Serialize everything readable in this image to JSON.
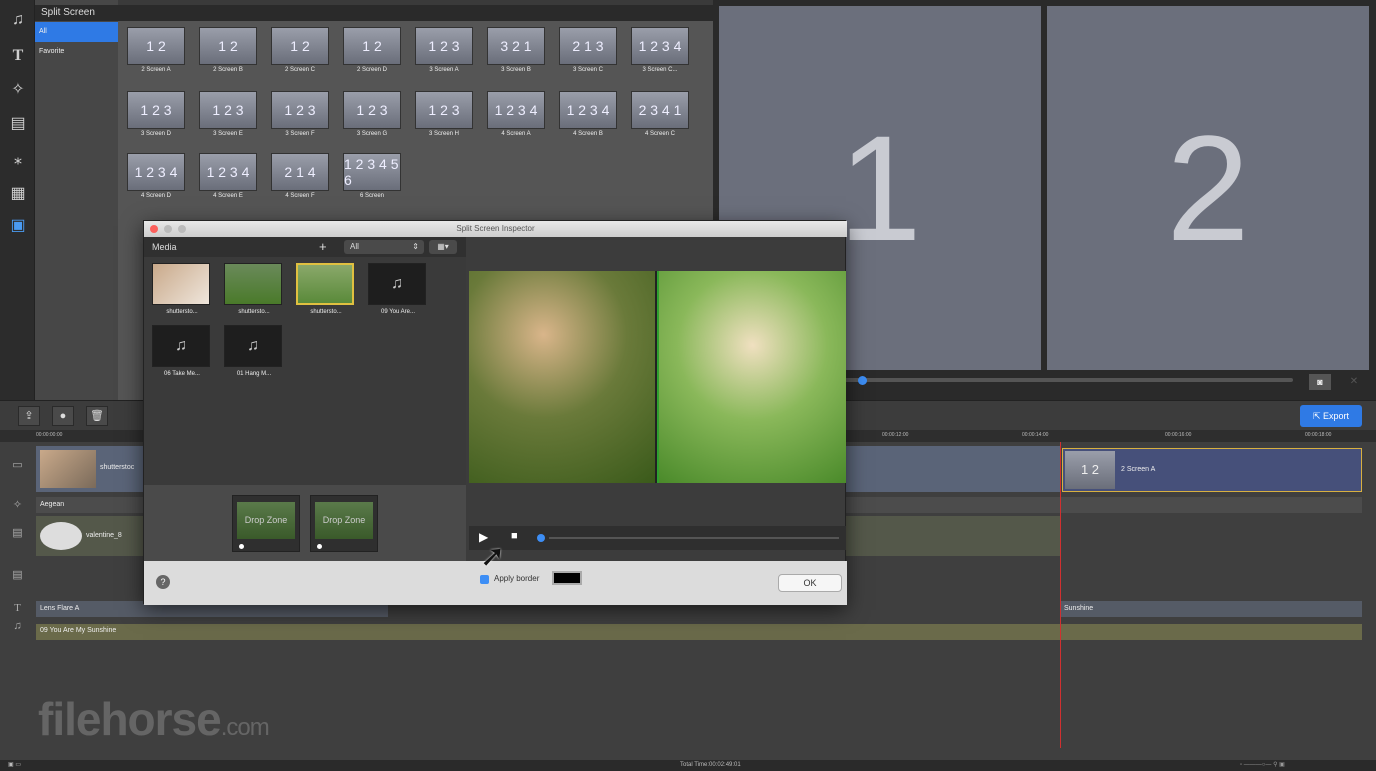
{
  "header": {
    "title": "Split Screen"
  },
  "categories": [
    {
      "label": "All"
    },
    {
      "label": "Favorite"
    }
  ],
  "tiles": [
    {
      "label": "2 Screen A",
      "nums": "1 2"
    },
    {
      "label": "2 Screen B",
      "nums": "1 2"
    },
    {
      "label": "2 Screen C",
      "nums": "1 2"
    },
    {
      "label": "2 Screen D",
      "nums": "1 2"
    },
    {
      "label": "3 Screen A",
      "nums": "1 2 3"
    },
    {
      "label": "3 Screen B",
      "nums": "3 2 1"
    },
    {
      "label": "3 Screen C",
      "nums": "2 1 3"
    },
    {
      "label": "3 Screen C...",
      "nums": "1 2 3 4"
    },
    {
      "label": "3 Screen D",
      "nums": "1 2 3"
    },
    {
      "label": "3 Screen E",
      "nums": "1 2 3"
    },
    {
      "label": "3 Screen F",
      "nums": "1 2 3"
    },
    {
      "label": "3 Screen G",
      "nums": "1 2 3"
    },
    {
      "label": "3 Screen H",
      "nums": "1 2 3"
    },
    {
      "label": "4 Screen A",
      "nums": "1 2 3 4"
    },
    {
      "label": "4 Screen B",
      "nums": "1 2 3 4"
    },
    {
      "label": "4 Screen C",
      "nums": "2 3 4 1"
    },
    {
      "label": "4 Screen D",
      "nums": "1 2 3 4"
    },
    {
      "label": "4 Screen E",
      "nums": "1 2 3 4"
    },
    {
      "label": "4 Screen F",
      "nums": "2 1 4"
    },
    {
      "label": "6 Screen",
      "nums": "1 2 3 4 5 6"
    }
  ],
  "preview": {
    "left_number": "1",
    "right_number": "2"
  },
  "toolbar": {
    "export_label": "Export"
  },
  "ruler": {
    "t0": "00:00:00:00",
    "t1": "00:00:12:00",
    "t2": "00:00:14:00",
    "t3": "00:00:16:00",
    "t4": "00:00:18:00"
  },
  "tracks": {
    "clip1": "shutterstoc",
    "split_clip": "2 Screen A",
    "split_nums": "1 2",
    "transition": "Aegean",
    "overlay": "valentine_8",
    "title1": "Lens Flare A",
    "title2": "Sunshine",
    "audio": "09 You Are My Sunshine"
  },
  "watermark": {
    "main": "filehorse",
    "suffix": ".com"
  },
  "status": {
    "total_time": "Total Time:00:02:49:01"
  },
  "dialog": {
    "title": "Split Screen Inspector",
    "media_label": "Media",
    "filter": "All",
    "media_items": [
      {
        "label": "shuttersto..."
      },
      {
        "label": "shuttersto..."
      },
      {
        "label": "shuttersto..."
      },
      {
        "label": "09 You Are..."
      },
      {
        "label": "06 Take Me..."
      },
      {
        "label": "01 Hang M..."
      }
    ],
    "dropzone1": "Drop Zone",
    "dropzone2": "Drop Zone",
    "apply_border": "Apply border",
    "ok_label": "OK",
    "help": "?"
  }
}
